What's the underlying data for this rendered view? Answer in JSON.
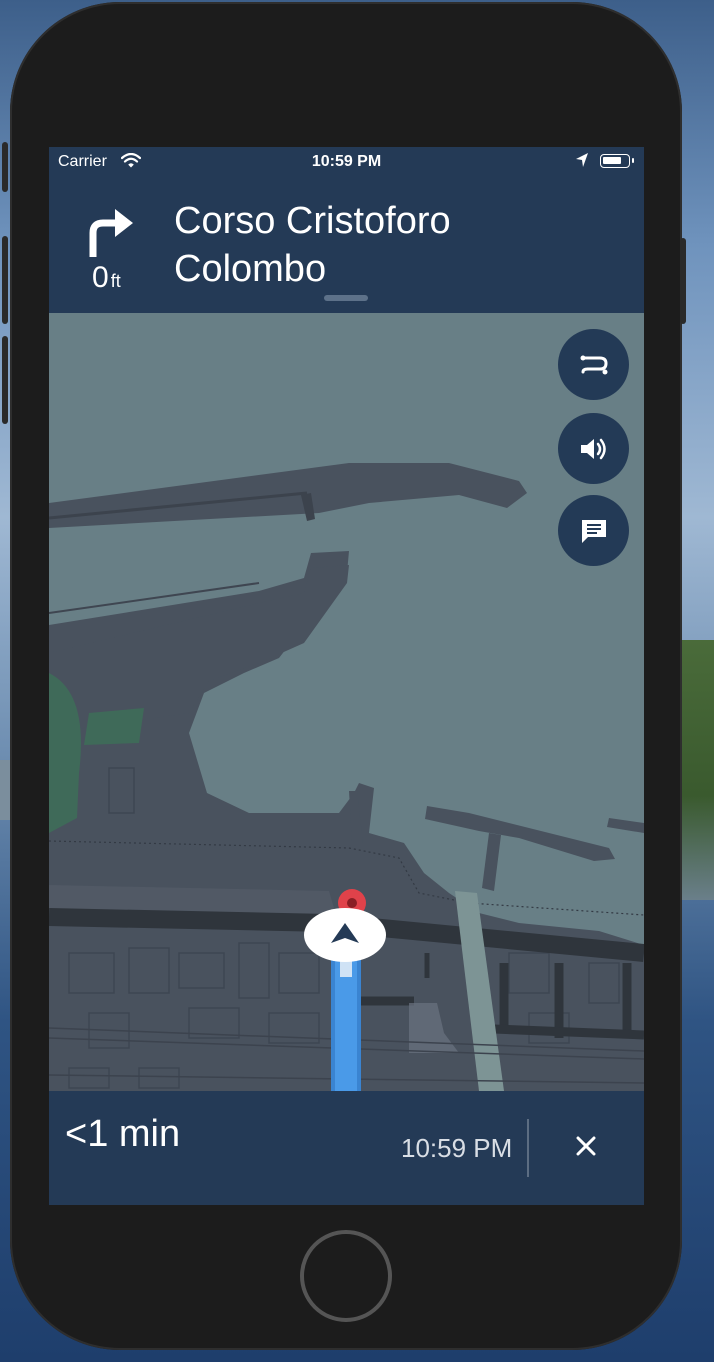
{
  "status_bar": {
    "carrier": "Carrier",
    "time": "10:59 PM",
    "wifi_icon": "wifi-icon",
    "location_icon": "location-arrow-icon",
    "battery_icon": "battery-icon"
  },
  "navigation": {
    "maneuver_icon": "turn-right-arrow-icon",
    "distance_value": "0",
    "distance_unit": "ft",
    "street_name": "Corso Cristoforo Colombo"
  },
  "map_controls": [
    {
      "name": "routes-overview-button",
      "icon": "route-icon"
    },
    {
      "name": "sound-button",
      "icon": "speaker-icon"
    },
    {
      "name": "feedback-button",
      "icon": "message-icon"
    }
  ],
  "trip": {
    "duration": "<1 min",
    "arrival_time": "10:59 PM",
    "close_icon": "close-icon"
  },
  "colors": {
    "header_bg": "#243a56",
    "map_water": "#687f86",
    "map_land": "#49525e",
    "route_blue": "#4a9ae8",
    "destination_red": "#e0424a"
  }
}
